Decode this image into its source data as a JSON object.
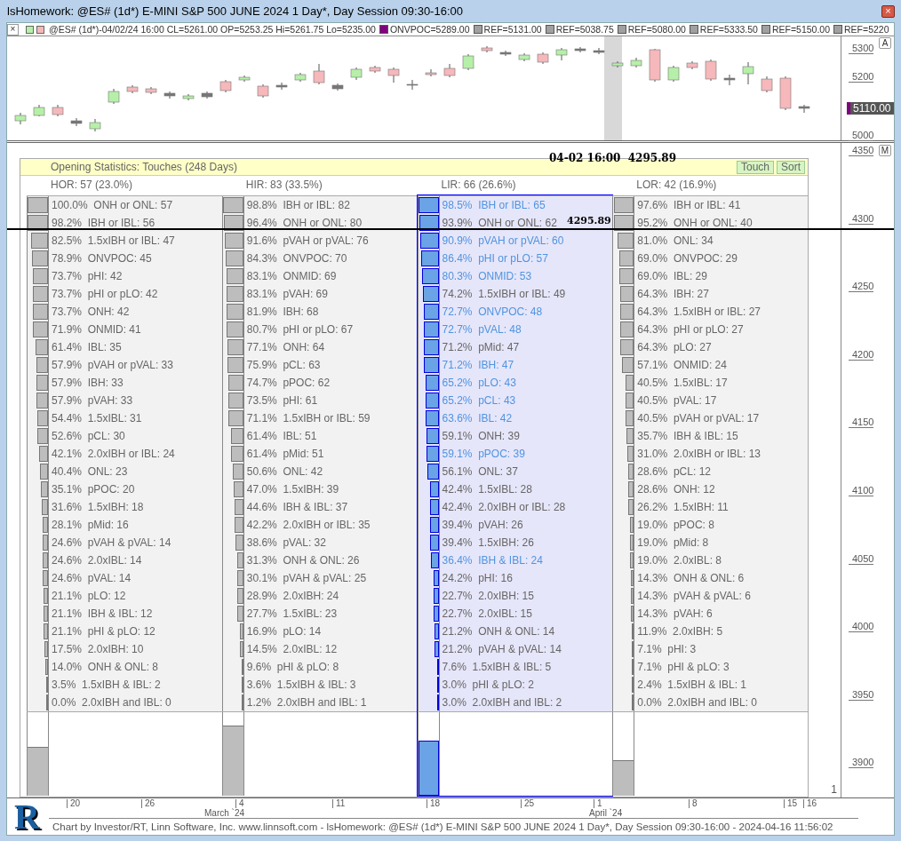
{
  "window": {
    "title": "lsHomework: @ES# (1d*) E-MINI S&P 500 JUNE 2024 1 Day*, Day Session 09:30-16:00",
    "close": "×"
  },
  "legend": {
    "close": "×",
    "bar_info": "@ES# (1d*)-04/02/24 16:00 CL=5261.00 OP=5253.25 Hi=5261.75 Lo=5235.00",
    "items": [
      {
        "text": "ONVPOC=5289.00",
        "color": "#800080"
      },
      {
        "text": "REF=5131.00",
        "color": "#a0a0a0"
      },
      {
        "text": "REF=5038.75",
        "color": "#a0a0a0"
      },
      {
        "text": "REF=5080.00",
        "color": "#a0a0a0"
      },
      {
        "text": "REF=5333.50",
        "color": "#a0a0a0"
      },
      {
        "text": "REF=5150.00",
        "color": "#a0a0a0"
      },
      {
        "text": "REF=5220",
        "color": "#a0a0a0"
      }
    ]
  },
  "price_pane": {
    "scale_button": "A",
    "ticks": [
      {
        "label": "5300"
      },
      {
        "label": "5200"
      },
      {
        "label": "5000"
      }
    ],
    "price_tag": "5110.00"
  },
  "stats_pane": {
    "scale_button": "M",
    "ticks": [
      "4350",
      "4300",
      "4250",
      "4200",
      "4150",
      "4100",
      "4050",
      "4000",
      "3950",
      "3900"
    ],
    "pane_number": "1",
    "crosshair": {
      "time": "04-02 16:00",
      "value": "4295.89"
    },
    "cursor_value": "4295.89"
  },
  "panel": {
    "title": "Opening Statistics: Touches (248 Days)",
    "buttons": [
      "Touch",
      "Sort"
    ],
    "columns": [
      {
        "header": "HOR: 57 (23.0%)",
        "selected": false,
        "level": 0.57,
        "rows": [
          {
            "text": "100.0%  ONH or ONL: 57",
            "level": 1.0,
            "highlighted": false
          },
          {
            "text": "98.2%  IBH or IBL: 56",
            "level": 0.982,
            "highlighted": false
          },
          {
            "text": "82.5%  1.5xIBH or IBL: 47",
            "level": 0.825,
            "highlighted": false
          },
          {
            "text": "78.9%  ONVPOC: 45",
            "level": 0.789,
            "highlighted": false
          },
          {
            "text": "73.7%  pHI: 42",
            "level": 0.737,
            "highlighted": false
          },
          {
            "text": "73.7%  pHI or pLO: 42",
            "level": 0.737,
            "highlighted": false
          },
          {
            "text": "73.7%  ONH: 42",
            "level": 0.737,
            "highlighted": false
          },
          {
            "text": "71.9%  ONMID: 41",
            "level": 0.719,
            "highlighted": false
          },
          {
            "text": "61.4%  IBL: 35",
            "level": 0.614,
            "highlighted": false
          },
          {
            "text": "57.9%  pVAH or pVAL: 33",
            "level": 0.579,
            "highlighted": false
          },
          {
            "text": "57.9%  IBH: 33",
            "level": 0.579,
            "highlighted": false
          },
          {
            "text": "57.9%  pVAH: 33",
            "level": 0.579,
            "highlighted": false
          },
          {
            "text": "54.4%  1.5xIBL: 31",
            "level": 0.544,
            "highlighted": false
          },
          {
            "text": "52.6%  pCL: 30",
            "level": 0.526,
            "highlighted": false
          },
          {
            "text": "42.1%  2.0xIBH or IBL: 24",
            "level": 0.421,
            "highlighted": false
          },
          {
            "text": "40.4%  ONL: 23",
            "level": 0.404,
            "highlighted": false
          },
          {
            "text": "35.1%  pPOC: 20",
            "level": 0.351,
            "highlighted": false
          },
          {
            "text": "31.6%  1.5xIBH: 18",
            "level": 0.316,
            "highlighted": false
          },
          {
            "text": "28.1%  pMid: 16",
            "level": 0.281,
            "highlighted": false
          },
          {
            "text": "24.6%  pVAH & pVAL: 14",
            "level": 0.246,
            "highlighted": false
          },
          {
            "text": "24.6%  2.0xIBL: 14",
            "level": 0.246,
            "highlighted": false
          },
          {
            "text": "24.6%  pVAL: 14",
            "level": 0.246,
            "highlighted": false
          },
          {
            "text": "21.1%  pLO: 12",
            "level": 0.211,
            "highlighted": false
          },
          {
            "text": "21.1%  IBH & IBL: 12",
            "level": 0.211,
            "highlighted": false
          },
          {
            "text": "21.1%  pHI & pLO: 12",
            "level": 0.211,
            "highlighted": false
          },
          {
            "text": "17.5%  2.0xIBH: 10",
            "level": 0.175,
            "highlighted": false
          },
          {
            "text": "14.0%  ONH & ONL: 8",
            "level": 0.14,
            "highlighted": false
          },
          {
            "text": "3.5%  1.5xIBH & IBL: 2",
            "level": 0.035,
            "highlighted": false
          },
          {
            "text": "0.0%  2.0xIBH and IBL: 0",
            "level": 0.0,
            "highlighted": false
          }
        ]
      },
      {
        "header": "HIR: 83 (33.5%)",
        "selected": false,
        "level": 0.83,
        "rows": [
          {
            "text": "98.8%  IBH or IBL: 82",
            "level": 0.988,
            "highlighted": false
          },
          {
            "text": "96.4%  ONH or ONL: 80",
            "level": 0.964,
            "highlighted": false
          },
          {
            "text": "91.6%  pVAH or pVAL: 76",
            "level": 0.916,
            "highlighted": false
          },
          {
            "text": "84.3%  ONVPOC: 70",
            "level": 0.843,
            "highlighted": false
          },
          {
            "text": "83.1%  ONMID: 69",
            "level": 0.831,
            "highlighted": false
          },
          {
            "text": "83.1%  pVAH: 69",
            "level": 0.831,
            "highlighted": false
          },
          {
            "text": "81.9%  IBH: 68",
            "level": 0.819,
            "highlighted": false
          },
          {
            "text": "80.7%  pHI or pLO: 67",
            "level": 0.807,
            "highlighted": false
          },
          {
            "text": "77.1%  ONH: 64",
            "level": 0.771,
            "highlighted": false
          },
          {
            "text": "75.9%  pCL: 63",
            "level": 0.759,
            "highlighted": false
          },
          {
            "text": "74.7%  pPOC: 62",
            "level": 0.747,
            "highlighted": false
          },
          {
            "text": "73.5%  pHI: 61",
            "level": 0.735,
            "highlighted": false
          },
          {
            "text": "71.1%  1.5xIBH or IBL: 59",
            "level": 0.711,
            "highlighted": false
          },
          {
            "text": "61.4%  IBL: 51",
            "level": 0.614,
            "highlighted": false
          },
          {
            "text": "61.4%  pMid: 51",
            "level": 0.614,
            "highlighted": false
          },
          {
            "text": "50.6%  ONL: 42",
            "level": 0.506,
            "highlighted": false
          },
          {
            "text": "47.0%  1.5xIBH: 39",
            "level": 0.47,
            "highlighted": false
          },
          {
            "text": "44.6%  IBH & IBL: 37",
            "level": 0.446,
            "highlighted": false
          },
          {
            "text": "42.2%  2.0xIBH or IBL: 35",
            "level": 0.422,
            "highlighted": false
          },
          {
            "text": "38.6%  pVAL: 32",
            "level": 0.386,
            "highlighted": false
          },
          {
            "text": "31.3%  ONH & ONL: 26",
            "level": 0.313,
            "highlighted": false
          },
          {
            "text": "30.1%  pVAH & pVAL: 25",
            "level": 0.301,
            "highlighted": false
          },
          {
            "text": "28.9%  2.0xIBH: 24",
            "level": 0.289,
            "highlighted": false
          },
          {
            "text": "27.7%  1.5xIBL: 23",
            "level": 0.277,
            "highlighted": false
          },
          {
            "text": "16.9%  pLO: 14",
            "level": 0.169,
            "highlighted": false
          },
          {
            "text": "14.5%  2.0xIBL: 12",
            "level": 0.145,
            "highlighted": false
          },
          {
            "text": "9.6%  pHI & pLO: 8",
            "level": 0.096,
            "highlighted": false
          },
          {
            "text": "3.6%  1.5xIBH & IBL: 3",
            "level": 0.036,
            "highlighted": false
          },
          {
            "text": "1.2%  2.0xIBH and IBL: 1",
            "level": 0.012,
            "highlighted": false
          }
        ]
      },
      {
        "header": "LIR: 66 (26.6%)",
        "selected": true,
        "level": 0.66,
        "rows": [
          {
            "text": "98.5%  IBH or IBL: 65",
            "level": 0.985,
            "highlighted": true
          },
          {
            "text": "93.9%  ONH or ONL: 62",
            "level": 0.939,
            "highlighted": false
          },
          {
            "text": "90.9%  pVAH or pVAL: 60",
            "level": 0.909,
            "highlighted": true
          },
          {
            "text": "86.4%  pHI or pLO: 57",
            "level": 0.864,
            "highlighted": true
          },
          {
            "text": "80.3%  ONMID: 53",
            "level": 0.803,
            "highlighted": true
          },
          {
            "text": "74.2%  1.5xIBH or IBL: 49",
            "level": 0.742,
            "highlighted": false
          },
          {
            "text": "72.7%  ONVPOC: 48",
            "level": 0.727,
            "highlighted": true
          },
          {
            "text": "72.7%  pVAL: 48",
            "level": 0.727,
            "highlighted": true
          },
          {
            "text": "71.2%  pMid: 47",
            "level": 0.712,
            "highlighted": false
          },
          {
            "text": "71.2%  IBH: 47",
            "level": 0.712,
            "highlighted": true
          },
          {
            "text": "65.2%  pLO: 43",
            "level": 0.652,
            "highlighted": true
          },
          {
            "text": "65.2%  pCL: 43",
            "level": 0.652,
            "highlighted": true
          },
          {
            "text": "63.6%  IBL: 42",
            "level": 0.636,
            "highlighted": true
          },
          {
            "text": "59.1%  ONH: 39",
            "level": 0.591,
            "highlighted": false
          },
          {
            "text": "59.1%  pPOC: 39",
            "level": 0.591,
            "highlighted": true
          },
          {
            "text": "56.1%  ONL: 37",
            "level": 0.561,
            "highlighted": false
          },
          {
            "text": "42.4%  1.5xIBL: 28",
            "level": 0.424,
            "highlighted": false
          },
          {
            "text": "42.4%  2.0xIBH or IBL: 28",
            "level": 0.424,
            "highlighted": false
          },
          {
            "text": "39.4%  pVAH: 26",
            "level": 0.394,
            "highlighted": false
          },
          {
            "text": "39.4%  1.5xIBH: 26",
            "level": 0.394,
            "highlighted": false
          },
          {
            "text": "36.4%  IBH & IBL: 24",
            "level": 0.364,
            "highlighted": true
          },
          {
            "text": "24.2%  pHI: 16",
            "level": 0.242,
            "highlighted": false
          },
          {
            "text": "22.7%  2.0xIBH: 15",
            "level": 0.227,
            "highlighted": false
          },
          {
            "text": "22.7%  2.0xIBL: 15",
            "level": 0.227,
            "highlighted": false
          },
          {
            "text": "21.2%  ONH & ONL: 14",
            "level": 0.212,
            "highlighted": false
          },
          {
            "text": "21.2%  pVAH & pVAL: 14",
            "level": 0.212,
            "highlighted": false
          },
          {
            "text": "7.6%  1.5xIBH & IBL: 5",
            "level": 0.076,
            "highlighted": false
          },
          {
            "text": "3.0%  pHI & pLO: 2",
            "level": 0.03,
            "highlighted": false
          },
          {
            "text": "3.0%  2.0xIBH and IBL: 2",
            "level": 0.03,
            "highlighted": false
          }
        ]
      },
      {
        "header": "LOR: 42 (16.9%)",
        "selected": false,
        "level": 0.42,
        "rows": [
          {
            "text": "97.6%  IBH or IBL: 41",
            "level": 0.976,
            "highlighted": false
          },
          {
            "text": "95.2%  ONH or ONL: 40",
            "level": 0.952,
            "highlighted": false
          },
          {
            "text": "81.0%  ONL: 34",
            "level": 0.81,
            "highlighted": false
          },
          {
            "text": "69.0%  ONVPOC: 29",
            "level": 0.69,
            "highlighted": false
          },
          {
            "text": "69.0%  IBL: 29",
            "level": 0.69,
            "highlighted": false
          },
          {
            "text": "64.3%  IBH: 27",
            "level": 0.643,
            "highlighted": false
          },
          {
            "text": "64.3%  1.5xIBH or IBL: 27",
            "level": 0.643,
            "highlighted": false
          },
          {
            "text": "64.3%  pHI or pLO: 27",
            "level": 0.643,
            "highlighted": false
          },
          {
            "text": "64.3%  pLO: 27",
            "level": 0.643,
            "highlighted": false
          },
          {
            "text": "57.1%  ONMID: 24",
            "level": 0.571,
            "highlighted": false
          },
          {
            "text": "40.5%  1.5xIBL: 17",
            "level": 0.405,
            "highlighted": false
          },
          {
            "text": "40.5%  pVAL: 17",
            "level": 0.405,
            "highlighted": false
          },
          {
            "text": "40.5%  pVAH or pVAL: 17",
            "level": 0.405,
            "highlighted": false
          },
          {
            "text": "35.7%  IBH & IBL: 15",
            "level": 0.357,
            "highlighted": false
          },
          {
            "text": "31.0%  2.0xIBH or IBL: 13",
            "level": 0.31,
            "highlighted": false
          },
          {
            "text": "28.6%  pCL: 12",
            "level": 0.286,
            "highlighted": false
          },
          {
            "text": "28.6%  ONH: 12",
            "level": 0.286,
            "highlighted": false
          },
          {
            "text": "26.2%  1.5xIBH: 11",
            "level": 0.262,
            "highlighted": false
          },
          {
            "text": "19.0%  pPOC: 8",
            "level": 0.19,
            "highlighted": false
          },
          {
            "text": "19.0%  pMid: 8",
            "level": 0.19,
            "highlighted": false
          },
          {
            "text": "19.0%  2.0xIBL: 8",
            "level": 0.19,
            "highlighted": false
          },
          {
            "text": "14.3%  ONH & ONL: 6",
            "level": 0.143,
            "highlighted": false
          },
          {
            "text": "14.3%  pVAH & pVAL: 6",
            "level": 0.143,
            "highlighted": false
          },
          {
            "text": "14.3%  pVAH: 6",
            "level": 0.143,
            "highlighted": false
          },
          {
            "text": "11.9%  2.0xIBH: 5",
            "level": 0.119,
            "highlighted": false
          },
          {
            "text": "7.1%  pHI: 3",
            "level": 0.071,
            "highlighted": false
          },
          {
            "text": "7.1%  pHI & pLO: 3",
            "level": 0.071,
            "highlighted": false
          },
          {
            "text": "2.4%  1.5xIBH & IBL: 1",
            "level": 0.024,
            "highlighted": false
          },
          {
            "text": "0.0%  2.0xIBH and IBL: 0",
            "level": 0.0,
            "highlighted": false
          }
        ]
      }
    ]
  },
  "date_axis": {
    "days": [
      {
        "label": "20"
      },
      {
        "label": "26"
      },
      {
        "label": "4"
      },
      {
        "label": "11"
      },
      {
        "label": "18"
      },
      {
        "label": "25"
      },
      {
        "label": "1"
      },
      {
        "label": "8"
      },
      {
        "label": "15"
      },
      {
        "label": "16"
      }
    ],
    "months": [
      {
        "label": "March `24"
      },
      {
        "label": "April `24"
      }
    ]
  },
  "footer": {
    "logo": "R",
    "text": "Chart by Investor/RT, Linn Software, Inc. www.linnsoft.com - lsHomework: @ES# (1d*) E-MINI S&P 500 JUNE 2024 1 Day*, Day Session 09:30-16:00 - 2024-04-16 11:56:02"
  }
}
